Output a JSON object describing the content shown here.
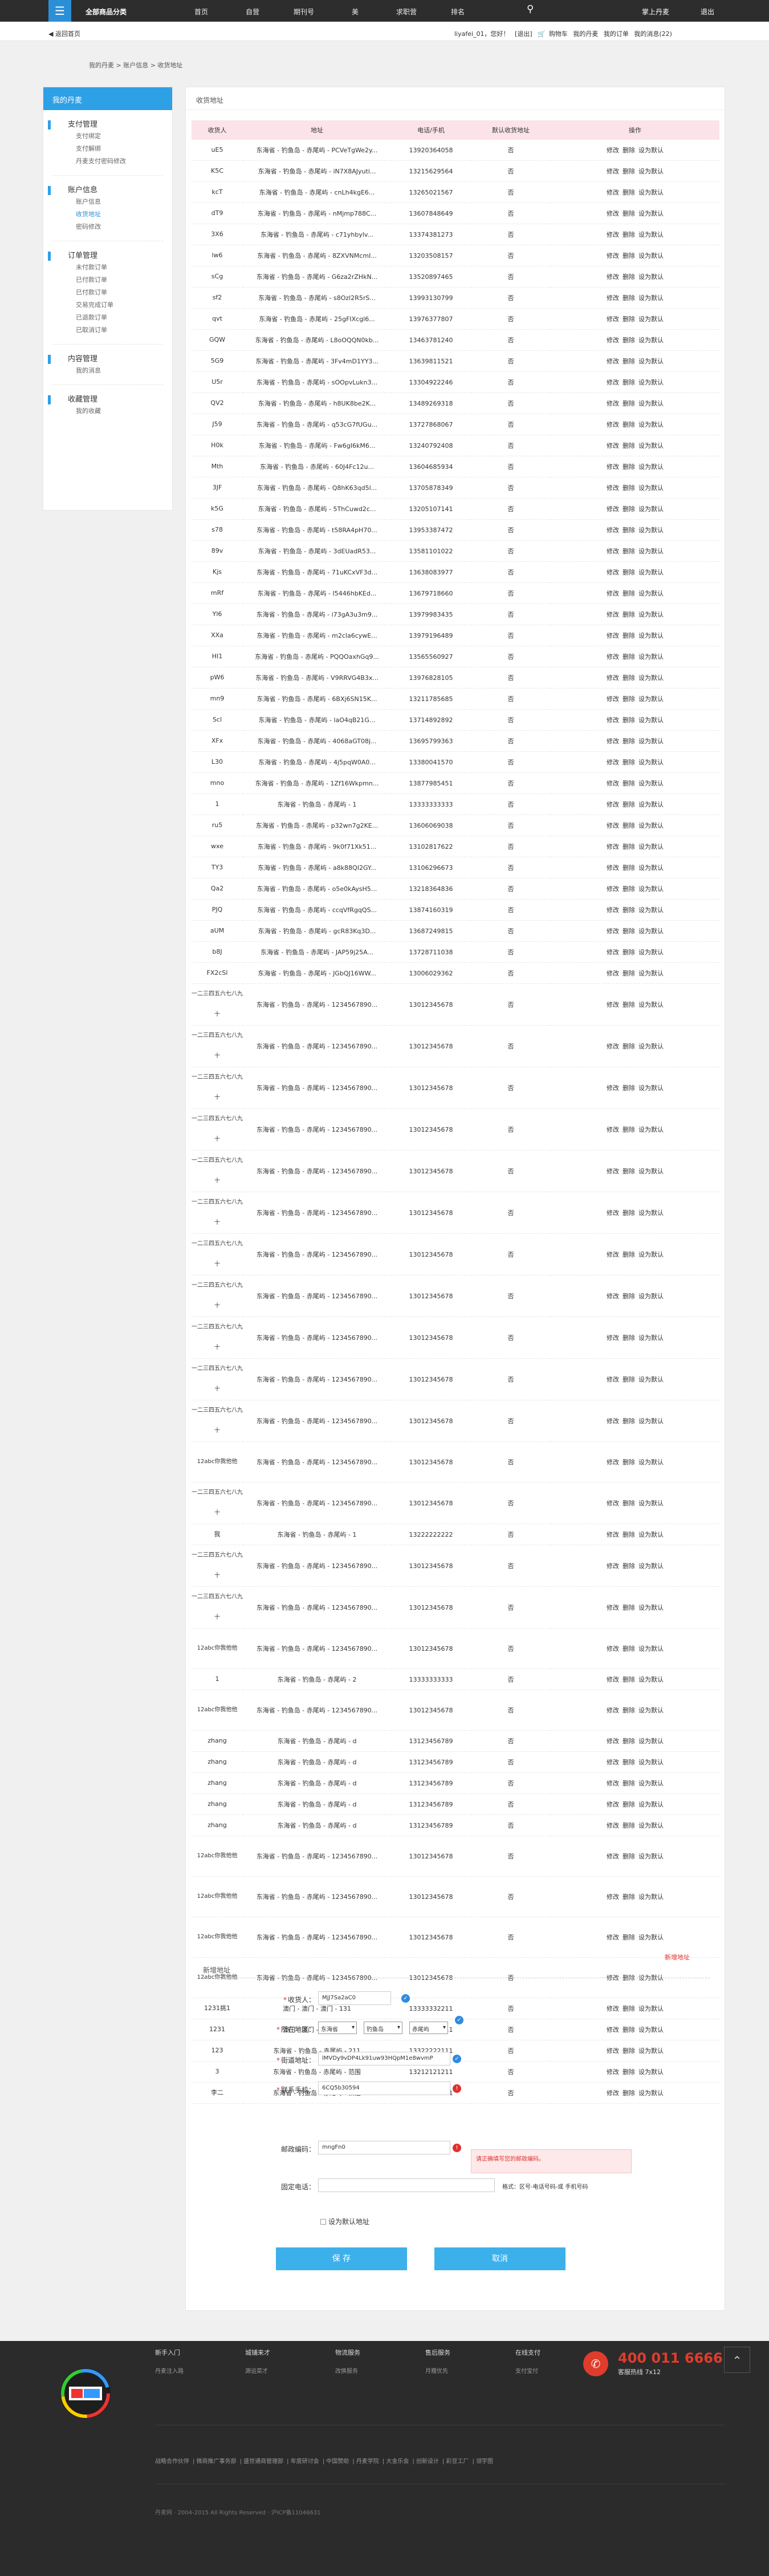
{
  "topbar": {
    "title": "全部商品分类",
    "nav": [
      "首页",
      "自营",
      "期刊号",
      "美",
      "求职营",
      "排名"
    ],
    "login": "掌上丹麦",
    "extra": "退出"
  },
  "userbar": {
    "back": "返回首页",
    "greeting": "liyafei_01，您好！",
    "exit": "[退出]",
    "cart": "购物车",
    "shop": "我的丹麦",
    "orders": "我的订单",
    "messages": "我的消息(22)"
  },
  "breadcrumb": "我的丹麦 > 账户信息 > 收货地址",
  "sidebar": {
    "head": "我的丹麦",
    "groups": [
      {
        "title": "支付管理",
        "items": [
          "支付绑定",
          "支付解绑",
          "丹麦支付密码修改"
        ]
      },
      {
        "title": "账户信息",
        "items": [
          "账户信息",
          "收货地址",
          "密码修改"
        ]
      },
      {
        "title": "订单管理",
        "items": [
          "未付款订单",
          "已付款订单",
          "已付款订单",
          "交易完成订单",
          "已退款订单",
          "已取消订单"
        ]
      },
      {
        "title": "内容管理",
        "items": [
          "我的消息"
        ]
      },
      {
        "title": "收藏管理",
        "items": [
          "我的收藏"
        ]
      }
    ]
  },
  "main": {
    "title": "收货地址",
    "columns": [
      "收货人",
      "地址",
      "电话/手机",
      "默认收货地址",
      "操作"
    ],
    "op_edit": "修改",
    "op_delete": "删除",
    "op_default": "设为默认",
    "rows": [
      [
        "uE5",
        "东海省 - 钓鱼岛 - 赤尾屿 - PCVeTgWe2y...",
        "13920364058",
        "否"
      ],
      [
        "K5C",
        "东海省 - 钓鱼岛 - 赤尾屿 - iN7X8AJyuti...",
        "13215629564",
        "否"
      ],
      [
        "kcT",
        "东海省 - 钓鱼岛 - 赤尾屿 - cnLh4kgE6...",
        "13265021567",
        "否"
      ],
      [
        "dT9",
        "东海省 - 钓鱼岛 - 赤尾屿 - nMjmp788C...",
        "13607848649",
        "否"
      ],
      [
        "3X6",
        "东海省 - 钓鱼岛 - 赤尾屿 - c71yhbylv...",
        "13374381273",
        "否"
      ],
      [
        "lw6",
        "东海省 - 钓鱼岛 - 赤尾屿 - 8ZXVNMcmI...",
        "13203508157",
        "否"
      ],
      [
        "sCg",
        "东海省 - 钓鱼岛 - 赤尾屿 - G6za2rZHkN...",
        "13520897465",
        "否"
      ],
      [
        "sf2",
        "东海省 - 钓鱼岛 - 赤尾屿 - s8Ozl2R5rS...",
        "13993130799",
        "否"
      ],
      [
        "qvt",
        "东海省 - 钓鱼岛 - 赤尾屿 - 25gFIXcgl6...",
        "13976377807",
        "否"
      ],
      [
        "GQW",
        "东海省 - 钓鱼岛 - 赤尾屿 - L8oOQQN0kb...",
        "13463781240",
        "否"
      ],
      [
        "5G9",
        "东海省 - 钓鱼岛 - 赤尾屿 - 3Fv4mD1YY3...",
        "13639811521",
        "否"
      ],
      [
        "U5r",
        "东海省 - 钓鱼岛 - 赤尾屿 - sOOpvLukn3...",
        "13304922246",
        "否"
      ],
      [
        "QV2",
        "东海省 - 钓鱼岛 - 赤尾屿 - h8UK8be2K...",
        "13489269318",
        "否"
      ],
      [
        "J59",
        "东海省 - 钓鱼岛 - 赤尾屿 - q53cG7fUGu...",
        "13727868067",
        "否"
      ],
      [
        "H0k",
        "东海省 - 钓鱼岛 - 赤尾屿 - Fw6gI6kM6...",
        "13240792408",
        "否"
      ],
      [
        "Mth",
        "东海省 - 钓鱼岛 - 赤尾屿 - 60J4Fc12u...",
        "13604685934",
        "否"
      ],
      [
        "3JF",
        "东海省 - 钓鱼岛 - 赤尾屿 - Q8hK63qd5l...",
        "13705878349",
        "否"
      ],
      [
        "k5G",
        "东海省 - 钓鱼岛 - 赤尾屿 - 5ThCuwd2c...",
        "13205107141",
        "否"
      ],
      [
        "s78",
        "东海省 - 钓鱼岛 - 赤尾屿 - t58RA4pH70...",
        "13953387472",
        "否"
      ],
      [
        "89v",
        "东海省 - 钓鱼岛 - 赤尾屿 - 3dEUadR53...",
        "13581101022",
        "否"
      ],
      [
        "Kjs",
        "东海省 - 钓鱼岛 - 赤尾屿 - 71uKCxVF3d...",
        "13638083977",
        "否"
      ],
      [
        "mRf",
        "东海省 - 钓鱼岛 - 赤尾屿 - I5446hbKEd...",
        "13679718660",
        "否"
      ],
      [
        "Yl6",
        "东海省 - 钓鱼岛 - 赤尾屿 - i73gA3u3m9...",
        "13979983435",
        "否"
      ],
      [
        "XXa",
        "东海省 - 钓鱼岛 - 赤尾屿 - m2cla6cywE...",
        "13979196489",
        "否"
      ],
      [
        "HI1",
        "东海省 - 钓鱼岛 - 赤尾屿 - PQQOaxhGq9...",
        "13565560927",
        "否"
      ],
      [
        "pW6",
        "东海省 - 钓鱼岛 - 赤尾屿 - V9RRVG4B3x...",
        "13976828105",
        "否"
      ],
      [
        "mn9",
        "东海省 - 钓鱼岛 - 赤尾屿 - 6BXj6SN15K...",
        "13211785685",
        "否"
      ],
      [
        "Scl",
        "东海省 - 钓鱼岛 - 赤尾屿 - laO4qB21G...",
        "13714892892",
        "否"
      ],
      [
        "XFx",
        "东海省 - 钓鱼岛 - 赤尾屿 - 4068aGT08j...",
        "13695799363",
        "否"
      ],
      [
        "L30",
        "东海省 - 钓鱼岛 - 赤尾屿 - 4j5pqW0A0...",
        "13380041570",
        "否"
      ],
      [
        "mno",
        "东海省 - 钓鱼岛 - 赤尾屿 - 1Zf16Wkpmn...",
        "13877985451",
        "否"
      ],
      [
        "1",
        "东海省 - 钓鱼岛 - 赤尾屿 - 1",
        "13333333333",
        "否"
      ],
      [
        "ru5",
        "东海省 - 钓鱼岛 - 赤尾屿 - p32wn7g2KE...",
        "13606069038",
        "否"
      ],
      [
        "wxe",
        "东海省 - 钓鱼岛 - 赤尾屿 - 9k0f71Xk51...",
        "13102817622",
        "否"
      ],
      [
        "TY3",
        "东海省 - 钓鱼岛 - 赤尾屿 - a8k88QI2GY...",
        "13106296673",
        "否"
      ],
      [
        "Qa2",
        "东海省 - 钓鱼岛 - 赤尾屿 - o5e0kAysH5...",
        "13218364836",
        "否"
      ],
      [
        "PJQ",
        "东海省 - 钓鱼岛 - 赤尾屿 - ccqVfRgqQS...",
        "13874160319",
        "否"
      ],
      [
        "aUM",
        "东海省 - 钓鱼岛 - 赤尾屿 - gcR83Kq3D...",
        "13687249815",
        "否"
      ],
      [
        "b8J",
        "东海省 - 钓鱼岛 - 赤尾屿 - JAP59j25A...",
        "13728711038",
        "否"
      ],
      [
        "FX2cSl",
        "东海省 - 钓鱼岛 - 赤尾屿 - JGbQJ16WW...",
        "13006029362",
        "否"
      ],
      [
        "一二三四五六七八九十",
        "东海省 - 钓鱼岛 - 赤尾屿 - 1234567890...",
        "13012345678",
        "否"
      ],
      [
        "一二三四五六七八九十",
        "东海省 - 钓鱼岛 - 赤尾屿 - 1234567890...",
        "13012345678",
        "否"
      ],
      [
        "一二三四五六七八九十",
        "东海省 - 钓鱼岛 - 赤尾屿 - 1234567890...",
        "13012345678",
        "否"
      ],
      [
        "一二三四五六七八九十",
        "东海省 - 钓鱼岛 - 赤尾屿 - 1234567890...",
        "13012345678",
        "否"
      ],
      [
        "一二三四五六七八九十",
        "东海省 - 钓鱼岛 - 赤尾屿 - 1234567890...",
        "13012345678",
        "否"
      ],
      [
        "一二三四五六七八九十",
        "东海省 - 钓鱼岛 - 赤尾屿 - 1234567890...",
        "13012345678",
        "否"
      ],
      [
        "一二三四五六七八九十",
        "东海省 - 钓鱼岛 - 赤尾屿 - 1234567890...",
        "13012345678",
        "否"
      ],
      [
        "一二三四五六七八九十",
        "东海省 - 钓鱼岛 - 赤尾屿 - 1234567890...",
        "13012345678",
        "否"
      ],
      [
        "一二三四五六七八九十",
        "东海省 - 钓鱼岛 - 赤尾屿 - 1234567890...",
        "13012345678",
        "否"
      ],
      [
        "一二三四五六七八九十",
        "东海省 - 钓鱼岛 - 赤尾屿 - 1234567890...",
        "13012345678",
        "否"
      ],
      [
        "一二三四五六七八九十",
        "东海省 - 钓鱼岛 - 赤尾屿 - 1234567890...",
        "13012345678",
        "否"
      ],
      [
        "12abc你我他他",
        "东海省 - 钓鱼岛 - 赤尾屿 - 1234567890...",
        "13012345678",
        "否"
      ],
      [
        "一二三四五六七八九十",
        "东海省 - 钓鱼岛 - 赤尾屿 - 1234567890...",
        "13012345678",
        "否"
      ],
      [
        "我",
        "东海省 - 钓鱼岛 - 赤尾屿 - 1",
        "13222222222",
        "否"
      ],
      [
        "一二三四五六七八九十",
        "东海省 - 钓鱼岛 - 赤尾屿 - 1234567890...",
        "13012345678",
        "否"
      ],
      [
        "一二三四五六七八九十",
        "东海省 - 钓鱼岛 - 赤尾屿 - 1234567890...",
        "13012345678",
        "否"
      ],
      [
        "12abc你我他他",
        "东海省 - 钓鱼岛 - 赤尾屿 - 1234567890...",
        "13012345678",
        "否"
      ],
      [
        "1",
        "东海省 - 钓鱼岛 - 赤尾屿 - 2",
        "13333333333",
        "否"
      ],
      [
        "12abc你我他他",
        "东海省 - 钓鱼岛 - 赤尾屿 - 1234567890...",
        "13012345678",
        "否"
      ],
      [
        "zhang",
        "东海省 - 钓鱼岛 - 赤尾屿 - d",
        "13123456789",
        "否"
      ],
      [
        "zhang",
        "东海省 - 钓鱼岛 - 赤尾屿 - d",
        "13123456789",
        "否"
      ],
      [
        "zhang",
        "东海省 - 钓鱼岛 - 赤尾屿 - d",
        "13123456789",
        "否"
      ],
      [
        "zhang",
        "东海省 - 钓鱼岛 - 赤尾屿 - d",
        "13123456789",
        "否"
      ],
      [
        "zhang",
        "东海省 - 钓鱼岛 - 赤尾屿 - d",
        "13123456789",
        "否"
      ],
      [
        "12abc你我他他",
        "东海省 - 钓鱼岛 - 赤尾屿 - 1234567890...",
        "13012345678",
        "否"
      ],
      [
        "12abc你我他他",
        "东海省 - 钓鱼岛 - 赤尾屿 - 1234567890...",
        "13012345678",
        "否"
      ],
      [
        "12abc你我他他",
        "东海省 - 钓鱼岛 - 赤尾屿 - 1234567890...",
        "13012345678",
        "否"
      ],
      [
        "12abc你我他他",
        "东海省 - 钓鱼岛 - 赤尾屿 - 1234567890...",
        "13012345678",
        "否"
      ],
      [
        "1231挑1",
        "澳门 - 澳门 - 澳门 - 131",
        "13333332211",
        "否"
      ],
      [
        "1231",
        "澳门 - 澳门 - 澳门 - 131",
        "13333332211",
        "否"
      ],
      [
        "123",
        "东海省 - 钓鱼岛 - 赤尾屿 - 211",
        "13322222111",
        "否"
      ],
      [
        "3",
        "东海省 - 钓鱼岛 - 赤尾屿 - 范围",
        "13212121211",
        "否"
      ],
      [
        "李二",
        "东海省 - 钓鱼岛 - 赤尾屿 - 新建",
        "13322221111",
        "否"
      ]
    ]
  },
  "form": {
    "title": "新增地址",
    "hint": "新增地址",
    "name_label": "收货人：",
    "name_value": "MjJ7Sa2aC0",
    "region_label": "所在地区：",
    "province": "东海省",
    "city": "钓鱼岛",
    "district": "赤尾屿",
    "street_label": "街道地址：",
    "street_value": "lMVDy9vDP4Lk91uw93HQpM1e8wvmP",
    "mobile_label": "联系手机：",
    "mobile_value": "6CQ5b30594",
    "zip_label": "邮政编码：",
    "zip_value": "mngFn0",
    "zip_error": "请正确填写您的邮政编码。",
    "phone_label": "固定电话：",
    "phone_hint": "格式：区号-电话号码-或 手机号码",
    "default_label": "设为默认地址",
    "save": "保 存",
    "cancel": "取消"
  },
  "footer": {
    "cols": [
      {
        "h": "新手入门",
        "l": "丹麦注入路"
      },
      {
        "h": "城铺来才",
        "l": "源运菜才"
      },
      {
        "h": "物流服务",
        "l": "改换服务"
      },
      {
        "h": "售后服务",
        "l": "月赠优先"
      },
      {
        "h": "在线支付",
        "l": "支付宝付"
      }
    ],
    "hotline": "400 011 6666",
    "hours": "客服热线 7x12",
    "links": [
      "战略合作伙伴",
      "微商推广事务部",
      "盛世通商管理部",
      "年度研讨会",
      "中国赞助",
      "丹麦学院",
      "大金乐会",
      "创新设计",
      "彩豆工厂",
      "领宇图"
    ],
    "copyright": "丹麦网 · 2004-2015 All Rights Reserved · 沪ICP备11046631",
    "colors": {
      "accent": "#2b8fd8",
      "error": "#e03030",
      "hotline": "#e03c2d"
    }
  }
}
